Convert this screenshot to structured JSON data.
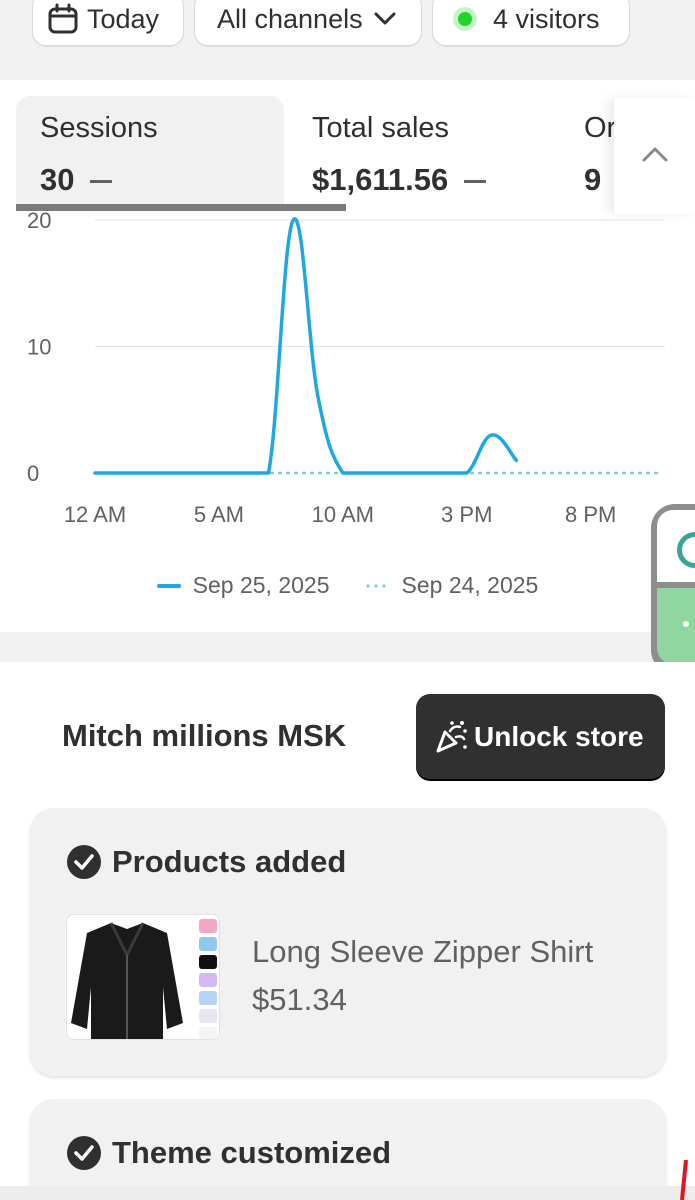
{
  "filters": {
    "date_label": "Today",
    "channels_label": "All channels",
    "visitors_label": "4 visitors"
  },
  "metrics": {
    "sessions": {
      "label": "Sessions",
      "value": "30"
    },
    "total_sales": {
      "label": "Total sales",
      "value": "$1,611.56"
    },
    "orders": {
      "label": "Orders",
      "value": "9"
    }
  },
  "chart_data": {
    "type": "line",
    "x_ticks": [
      "12 AM",
      "5 AM",
      "10 AM",
      "3 PM",
      "8 PM"
    ],
    "y_ticks": [
      0,
      10,
      20
    ],
    "ylim": [
      0,
      20
    ],
    "x_unit": "hour of day",
    "series": [
      {
        "name": "Sep 25, 2025",
        "style": "solid",
        "color": "#1ea7e1",
        "points": [
          [
            0,
            0
          ],
          [
            1,
            0
          ],
          [
            2,
            0
          ],
          [
            3,
            0
          ],
          [
            4,
            0
          ],
          [
            5,
            0
          ],
          [
            6,
            0
          ],
          [
            7,
            0
          ],
          [
            8,
            20
          ],
          [
            9,
            6
          ],
          [
            10,
            0
          ],
          [
            11,
            0
          ],
          [
            12,
            0
          ],
          [
            13,
            0
          ],
          [
            14,
            0
          ],
          [
            15,
            0
          ],
          [
            16,
            3
          ],
          [
            17,
            1
          ]
        ]
      },
      {
        "name": "Sep 24, 2025",
        "style": "dotted",
        "color": "#7fcde0",
        "points": [
          [
            0,
            0
          ],
          [
            23,
            0
          ]
        ]
      }
    ],
    "grid": true
  },
  "setup": {
    "store_name": "Mitch millions MSK",
    "unlock_label": "Unlock store",
    "tasks": [
      {
        "title": "Products added",
        "product": {
          "name": "Long Sleeve Zipper Shirt",
          "price": "$51.34"
        }
      },
      {
        "title": "Theme customized"
      }
    ]
  },
  "colors": {
    "accent_line": "#1ea7e1",
    "comparison_line": "#7fcde0",
    "button_dark": "#303030",
    "status_green": "#22d32a"
  }
}
